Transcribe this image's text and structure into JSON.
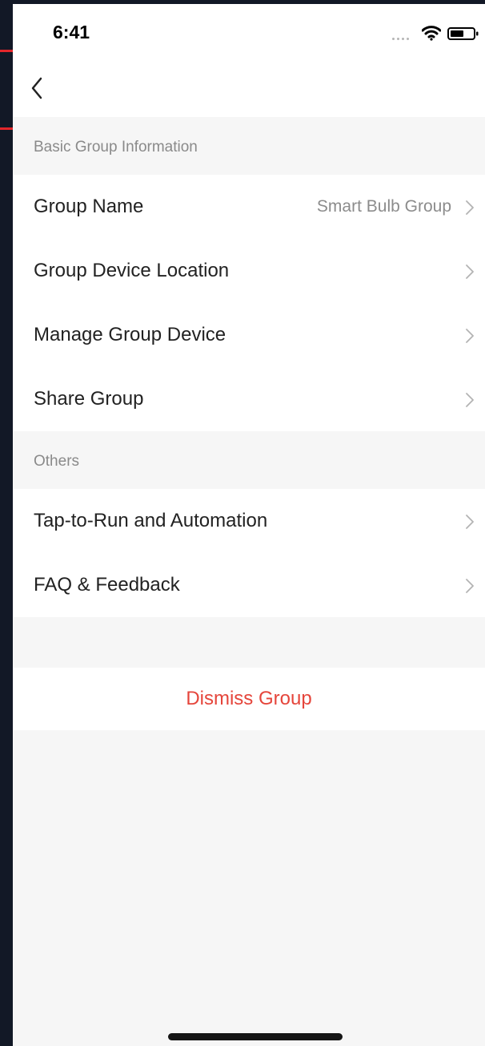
{
  "status_bar": {
    "time": "6:41"
  },
  "sections": {
    "basic_title": "Basic Group Information",
    "others_title": "Others"
  },
  "basic_items": [
    {
      "label": "Group Name",
      "value": "Smart Bulb Group"
    },
    {
      "label": "Group Device Location"
    },
    {
      "label": "Manage Group Device"
    },
    {
      "label": "Share Group"
    }
  ],
  "other_items": [
    {
      "label": "Tap-to-Run and Automation"
    },
    {
      "label": "FAQ & Feedback"
    }
  ],
  "dismiss_label": "Dismiss Group",
  "colors": {
    "accent_danger": "#e5453b",
    "page_background": "#f6f6f6",
    "outer_background": "#121826",
    "highlight_box": "#e3262b"
  },
  "icons": [
    "back-chevron-icon",
    "chevron-right-icon",
    "wifi-icon",
    "battery-icon",
    "cellular-signal-icon"
  ]
}
